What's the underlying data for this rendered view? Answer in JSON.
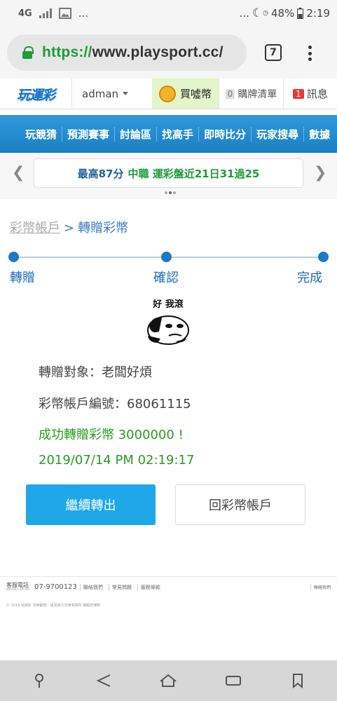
{
  "statusbar": {
    "network": "4G",
    "dots_left": "...",
    "dots_right": "...",
    "battery": "48%",
    "time": "2:19"
  },
  "browser": {
    "url_scheme": "https://",
    "url_rest": "www.playsport.cc/",
    "tab_count": "7"
  },
  "site": {
    "logo": "玩運彩",
    "user": "adman",
    "buy_label": "買噓幣",
    "cart_count": "0",
    "cart_label": "購牌清單",
    "msg_count": "1",
    "msg_label": "訊息"
  },
  "nav": {
    "items": [
      "玩競猜",
      "預測賽事",
      "討論區",
      "找高手",
      "即時比分",
      "玩家搜尋",
      "數據"
    ]
  },
  "ticker": {
    "text_main": "最高87分",
    "text_green": "中職 運彩盤近21日31過25"
  },
  "breadcrumb": {
    "parent": "彩幣帳戶",
    "sep": ">",
    "current": "轉贈彩幣"
  },
  "steps": [
    "轉贈",
    "確認",
    "完成"
  ],
  "sticker": {
    "caption": "好 我滾"
  },
  "result": {
    "recipient": "轉贈對象：老闆好煩",
    "account": "彩幣帳戶編號：68061115",
    "success": "成功轉贈彩幣 3000000 !",
    "datetime": "2019/07/14 PM 02:19:17"
  },
  "buttons": {
    "continue": "繼續轉出",
    "back": "回彩幣帳戶"
  },
  "footer": {
    "service_label": "客服電話",
    "service_hours": "09:00~24:00",
    "phone": "07-9700123",
    "links": [
      "聯絡我們",
      "常見問題",
      "服務條款"
    ],
    "contact": "聯絡我們",
    "copyright": "© 2019 玩運彩 法律顧問：遠見得力法律事務所 陳鍛宏律師"
  },
  "colors": {
    "accent": "#1ea8e8",
    "nav_blue": "#1b7fc4",
    "success_green": "#2a9a20",
    "link_blue": "#1c6ab8"
  }
}
